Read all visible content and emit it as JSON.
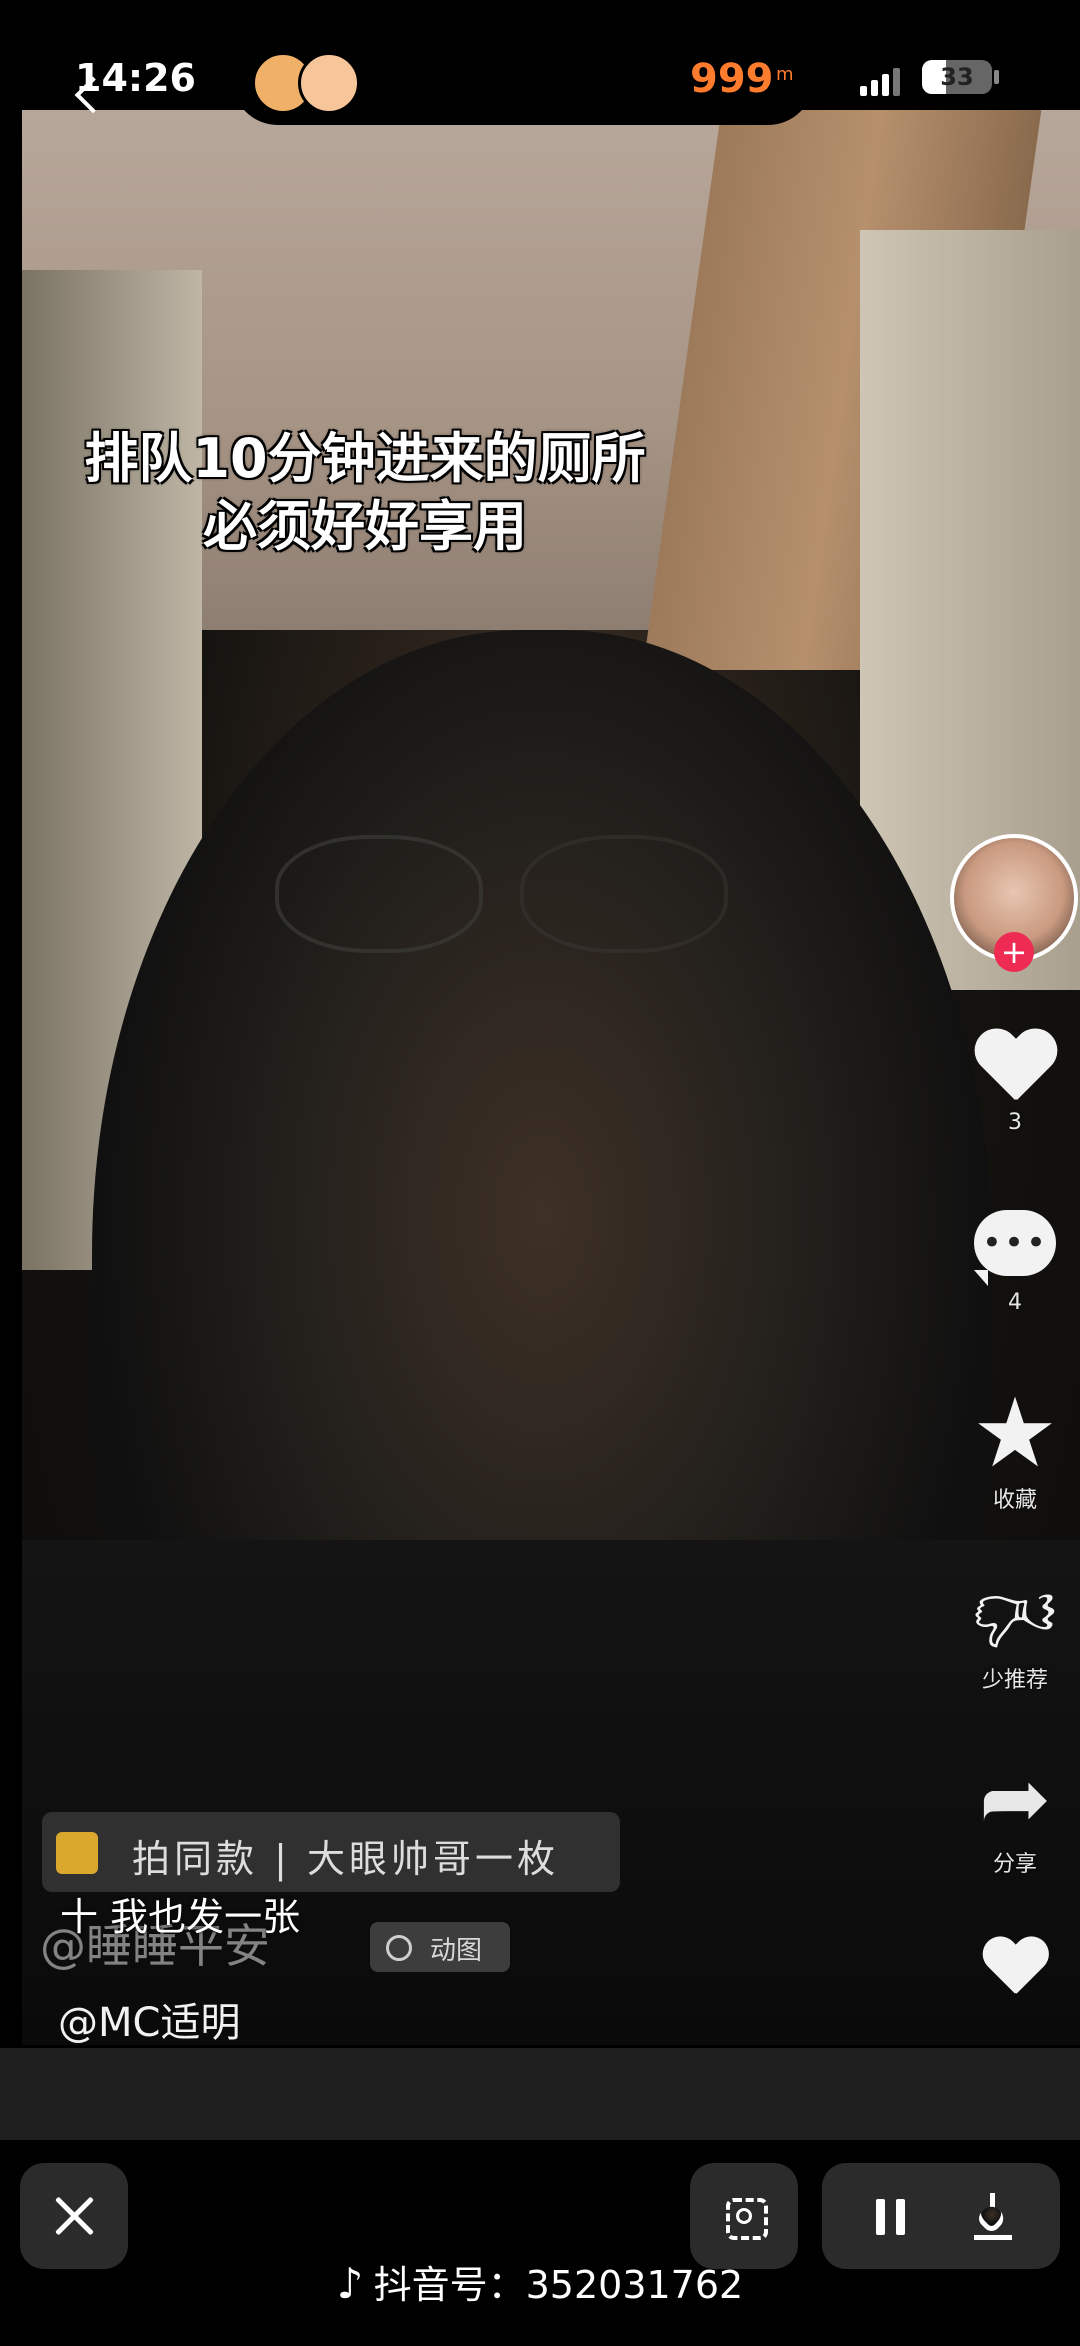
{
  "status_bar": {
    "time": "14:26",
    "island_value": "999",
    "island_unit": "m",
    "battery": "33"
  },
  "video": {
    "caption_line1": "排队10分钟进来的厕所",
    "caption_line2": "必须好好享用"
  },
  "right_rail": {
    "like_count": "3",
    "comment_count": "4",
    "favorite_label": "收藏",
    "less_recommend_label": "少推荐",
    "share_label": "分享"
  },
  "overlay": {
    "same_style_chip": "拍同款 | 大眼帅哥一枚",
    "post_button": "十 我也发一张",
    "ghost_username": "@睡睡平安",
    "gif_tag": "动图",
    "author": "@MC适明"
  },
  "bottom": {
    "watermark_label": "抖音号：",
    "watermark_id": "352031762"
  },
  "colors": {
    "accent_orange": "#ff7b2e",
    "follow_red": "#ee2b52"
  },
  "icons": [
    "back-icon",
    "signal-icon",
    "battery-icon",
    "follow-plus-icon",
    "heart-icon",
    "comment-icon",
    "star-icon",
    "thumb-down-icon",
    "share-icon",
    "close-icon",
    "scan-icon",
    "pause-icon",
    "download-icon",
    "tiktok-logo-icon"
  ]
}
